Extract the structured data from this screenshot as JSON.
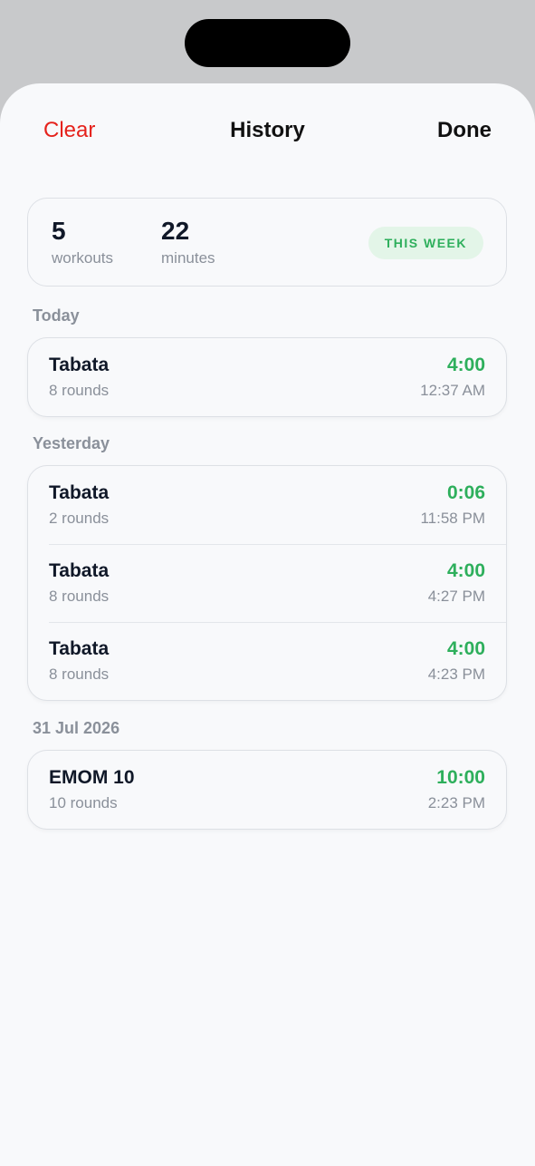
{
  "nav": {
    "clear_label": "Clear",
    "title": "History",
    "done_label": "Done"
  },
  "summary": {
    "workouts_value": "5",
    "workouts_label": "workouts",
    "minutes_value": "22",
    "minutes_label": "minutes",
    "period_badge": "THIS WEEK"
  },
  "sections": [
    {
      "label": "Today",
      "items": [
        {
          "name": "Tabata",
          "rounds": "8 rounds",
          "duration": "4:00",
          "time": "12:37 AM"
        }
      ]
    },
    {
      "label": "Yesterday",
      "items": [
        {
          "name": "Tabata",
          "rounds": "2 rounds",
          "duration": "0:06",
          "time": "11:58 PM"
        },
        {
          "name": "Tabata",
          "rounds": "8 rounds",
          "duration": "4:00",
          "time": "4:27 PM"
        },
        {
          "name": "Tabata",
          "rounds": "8 rounds",
          "duration": "4:00",
          "time": "4:23 PM"
        }
      ]
    },
    {
      "label": "31 Jul 2026",
      "items": [
        {
          "name": "EMOM 10",
          "rounds": "10 rounds",
          "duration": "10:00",
          "time": "2:23 PM"
        }
      ]
    }
  ],
  "colors": {
    "destructive": "#e5221c",
    "accent_green": "#2eaf5c",
    "badge_bg": "#e3f5e8"
  }
}
